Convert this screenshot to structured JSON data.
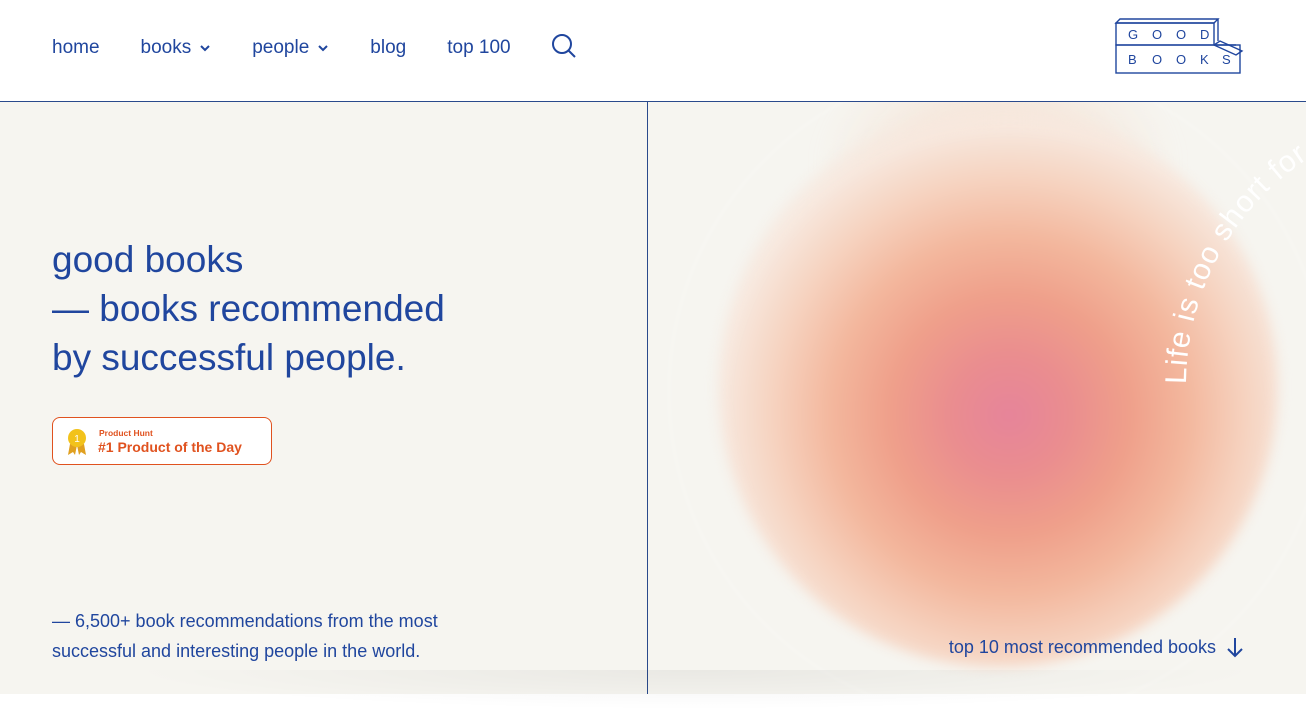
{
  "header": {
    "nav": [
      {
        "label": "home",
        "dropdown": false
      },
      {
        "label": "books",
        "dropdown": true
      },
      {
        "label": "people",
        "dropdown": true
      },
      {
        "label": "blog",
        "dropdown": false
      },
      {
        "label": "top 100",
        "dropdown": false
      }
    ],
    "search_icon": "search-icon",
    "logo": {
      "line1": [
        "G",
        "O",
        "O",
        "D"
      ],
      "line2": [
        "B",
        "O",
        "O",
        "K",
        "S"
      ]
    }
  },
  "hero": {
    "headline": [
      "good books",
      "— books recommended",
      "by successful people."
    ],
    "badge": {
      "small": "Product Hunt",
      "big": "#1 Product of the Day",
      "medal_number": "1"
    },
    "stat_line1": "— 6,500+ book recommendations from the most",
    "stat_line2": "successful and interesting people in the world.",
    "curved_text": "Life is too short for bad books. ",
    "top10_link": "top 10 most recommended books",
    "arrow_icon": "arrow-down-icon"
  },
  "colors": {
    "navy": "#20469e",
    "background": "#f6f5f0",
    "badge": "#e0521f"
  }
}
